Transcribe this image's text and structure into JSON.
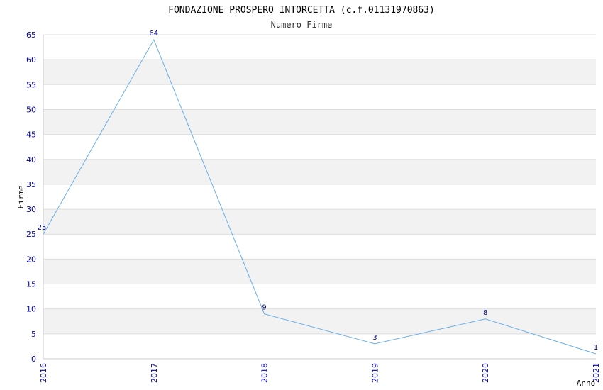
{
  "chart_data": {
    "type": "line",
    "title": "FONDAZIONE PROSPERO INTORCETTA (c.f.01131970863)",
    "subtitle": "Numero Firme",
    "xlabel": "Anno",
    "ylabel": "Firme",
    "categories": [
      "2016",
      "2017",
      "2018",
      "2019",
      "2020",
      "2021"
    ],
    "series": [
      {
        "values": [
          25,
          64,
          9,
          3,
          8,
          1
        ]
      }
    ],
    "data_labels": [
      "25",
      "64",
      "9",
      "3",
      "8",
      "1"
    ],
    "ylim": [
      0,
      65
    ],
    "yticks": [
      "0",
      "5",
      "10",
      "15",
      "20",
      "25",
      "30",
      "35",
      "40",
      "45",
      "50",
      "55",
      "60",
      "65"
    ],
    "grid": true,
    "colors": {
      "line": "#6aaee8",
      "band": "#f2f2f2",
      "grid": "#dddddd",
      "tick": "#0000aa",
      "data_label": "#00008b"
    }
  }
}
